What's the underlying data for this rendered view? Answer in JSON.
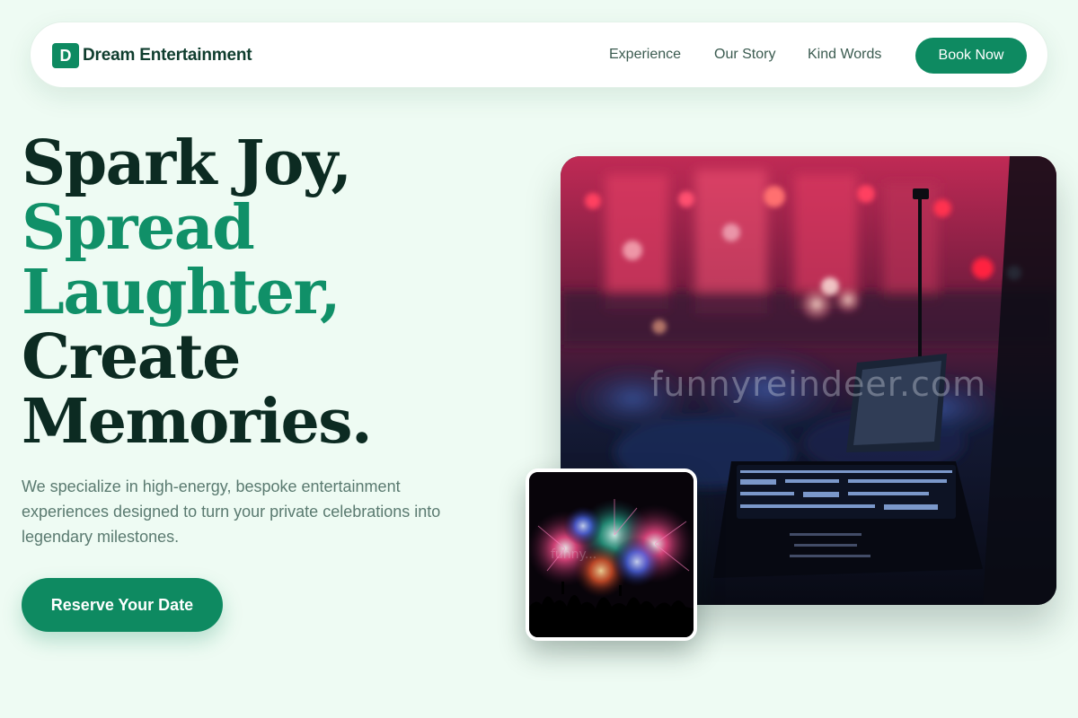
{
  "brand": {
    "mark": "D",
    "name": "Dream Entertainment"
  },
  "nav": {
    "links": [
      "Experience",
      "Our Story",
      "Kind Words"
    ],
    "book_label": "Book Now"
  },
  "hero": {
    "headline": [
      "Spark Joy,",
      "Spread",
      "Laughter,",
      "Create",
      "Memories."
    ],
    "subtext": "We specialize in high-energy, bespoke entertainment experiences designed to turn your private celebrations into legendary milestones.",
    "cta_label": "Reserve Your Date"
  },
  "images": {
    "main_watermark": "funnyreindeer.com",
    "small_watermark": "funny..."
  },
  "colors": {
    "accent": "#0e8a61",
    "headline_dark": "#0c2b22",
    "headline_accent": "#109068",
    "background": "#eefbf3"
  }
}
